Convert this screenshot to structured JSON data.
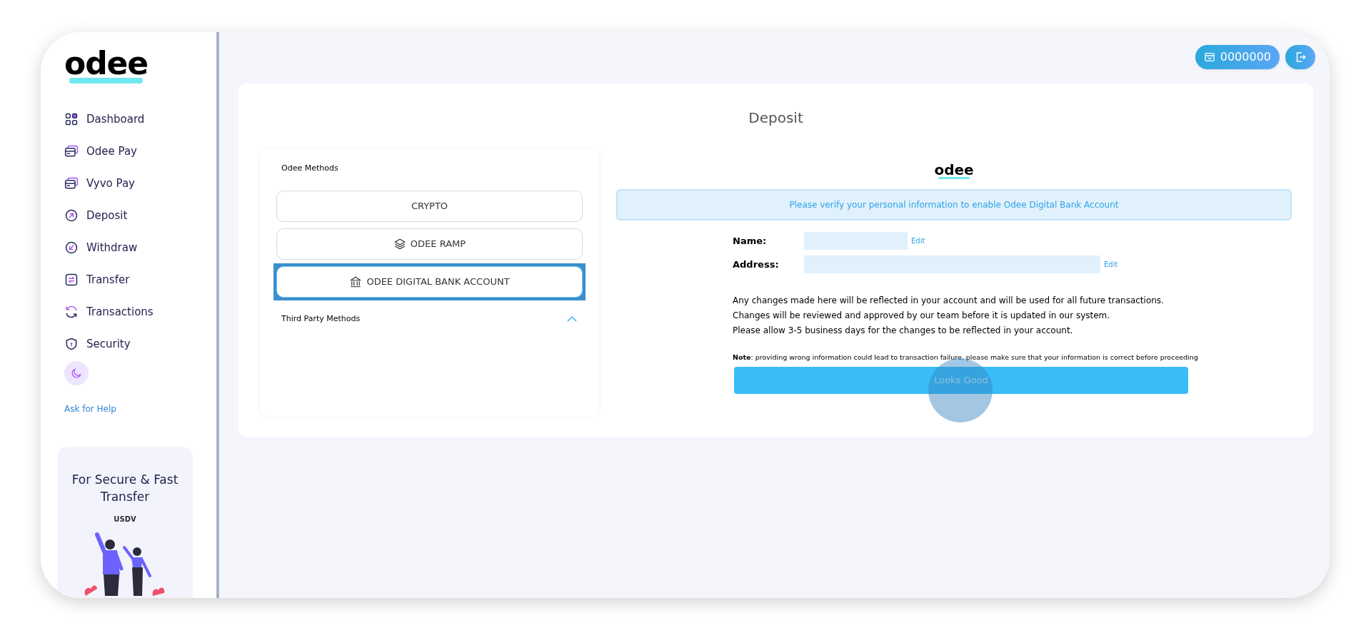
{
  "logo": "odee",
  "sidebar": {
    "items": [
      {
        "label": "Dashboard",
        "kind": "grid"
      },
      {
        "label": "Odee Pay",
        "kind": "cards"
      },
      {
        "label": "Vyvo Pay",
        "kind": "cards"
      },
      {
        "label": "Deposit",
        "kind": "up"
      },
      {
        "label": "Withdraw",
        "kind": "down"
      },
      {
        "label": "Transfer",
        "kind": "swap"
      },
      {
        "label": "Transactions",
        "kind": "refresh"
      },
      {
        "label": "Security",
        "kind": "shield"
      }
    ],
    "help_link": "Ask for Help",
    "promo": {
      "title": "For Secure & Fast Transfer",
      "sign": "USDV"
    }
  },
  "header": {
    "balance": "0000000"
  },
  "page_title": "Deposit",
  "odee_methods": {
    "title": "Odee Methods",
    "methods": [
      {
        "label": "CRYPTO",
        "kind": "plain",
        "selected": false
      },
      {
        "label": "ODEE RAMP",
        "kind": "layers",
        "selected": false
      },
      {
        "label": "ODEE DIGITAL BANK ACCOUNT",
        "kind": "bank",
        "selected": true
      }
    ]
  },
  "third_party": {
    "title": "Third Party Methods",
    "expanded": true
  },
  "bank": {
    "logo": "odee",
    "alert": "Please verify your personal information to enable Odee Digital Bank Account",
    "fields": [
      {
        "label": "Name:",
        "action": "Edit"
      },
      {
        "label": "Address:",
        "action": "Edit"
      }
    ],
    "info": [
      "Any changes made here will be reflected in your account and will be used for all future transactions.",
      "Changes will be reviewed and approved by our team before it is updated in our system.",
      "Please allow 3-5 business days for the changes to be reflected in your account."
    ],
    "note": "**Note**: providing wrong information could lead to transaction failure, please make sure that your information is correct before proceeding",
    "submit": "Looks Good"
  }
}
